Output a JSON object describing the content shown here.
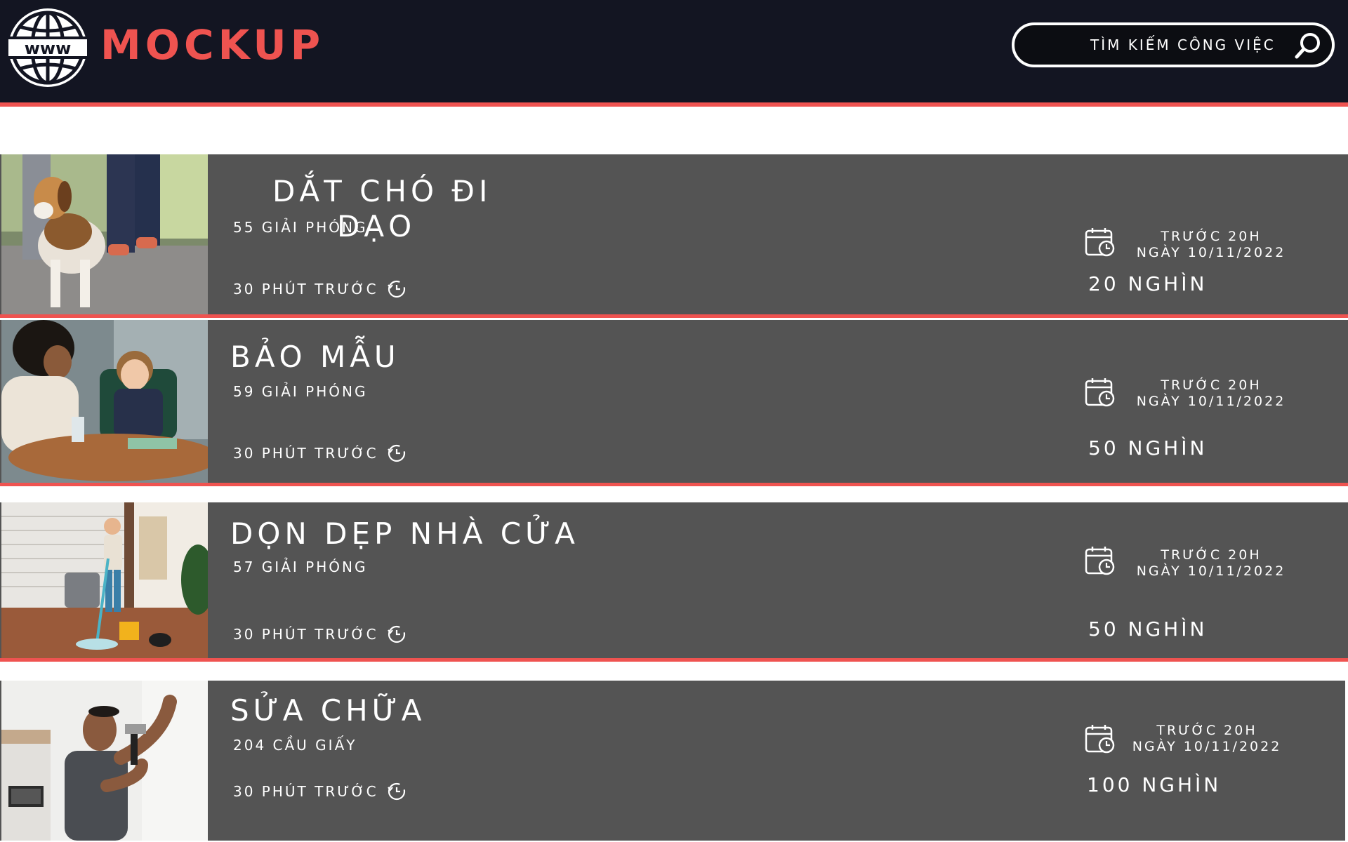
{
  "header": {
    "logo_text": "MOCKUP",
    "logo_icon": "www-globe-icon",
    "search_placeholder": "TÌM KIẾM CÔNG VIỆC",
    "search_icon": "magnifier-icon"
  },
  "colors": {
    "header_bg": "#131522",
    "accent": "#ef5350",
    "card_bg": "#545454",
    "text": "#ffffff"
  },
  "jobs": [
    {
      "title_line1": "DẮT CHÓ ĐI",
      "title_line2": "DẠO",
      "address": "55 GIẢI PHÓNG",
      "posted": "30 PHÚT TRƯỚC",
      "deadline_line1": "TRƯỚC 20H",
      "deadline_line2": "NGÀY 10/11/2022",
      "price": "20 NGHÌN",
      "image": "person-walking-beagle-photo"
    },
    {
      "title": "BẢO MẪU",
      "address": "59 GIẢI PHÓNG",
      "posted": "30 PHÚT TRƯỚC",
      "deadline_line1": "TRƯỚC 20H",
      "deadline_line2": "NGÀY 10/11/2022",
      "price": "50 NGHÌN",
      "image": "woman-helping-child-homework-photo"
    },
    {
      "title": "DỌN DẸP NHÀ CỬA",
      "address": "57 GIẢI PHÓNG",
      "posted": "30 PHÚT TRƯỚC",
      "deadline_line1": "TRƯỚC 20H",
      "deadline_line2": "NGÀY 10/11/2022",
      "price": "50 NGHÌN",
      "image": "woman-mopping-living-room-photo"
    },
    {
      "title": "SỬA CHỮA",
      "address": "204 CẦU GIẤY",
      "posted": "30 PHÚT TRƯỚC",
      "deadline_line1": "TRƯỚC 20H",
      "deadline_line2": "NGÀY 10/11/2022",
      "price": "100 NGHÌN",
      "image": "man-hammering-wall-photo"
    }
  ]
}
